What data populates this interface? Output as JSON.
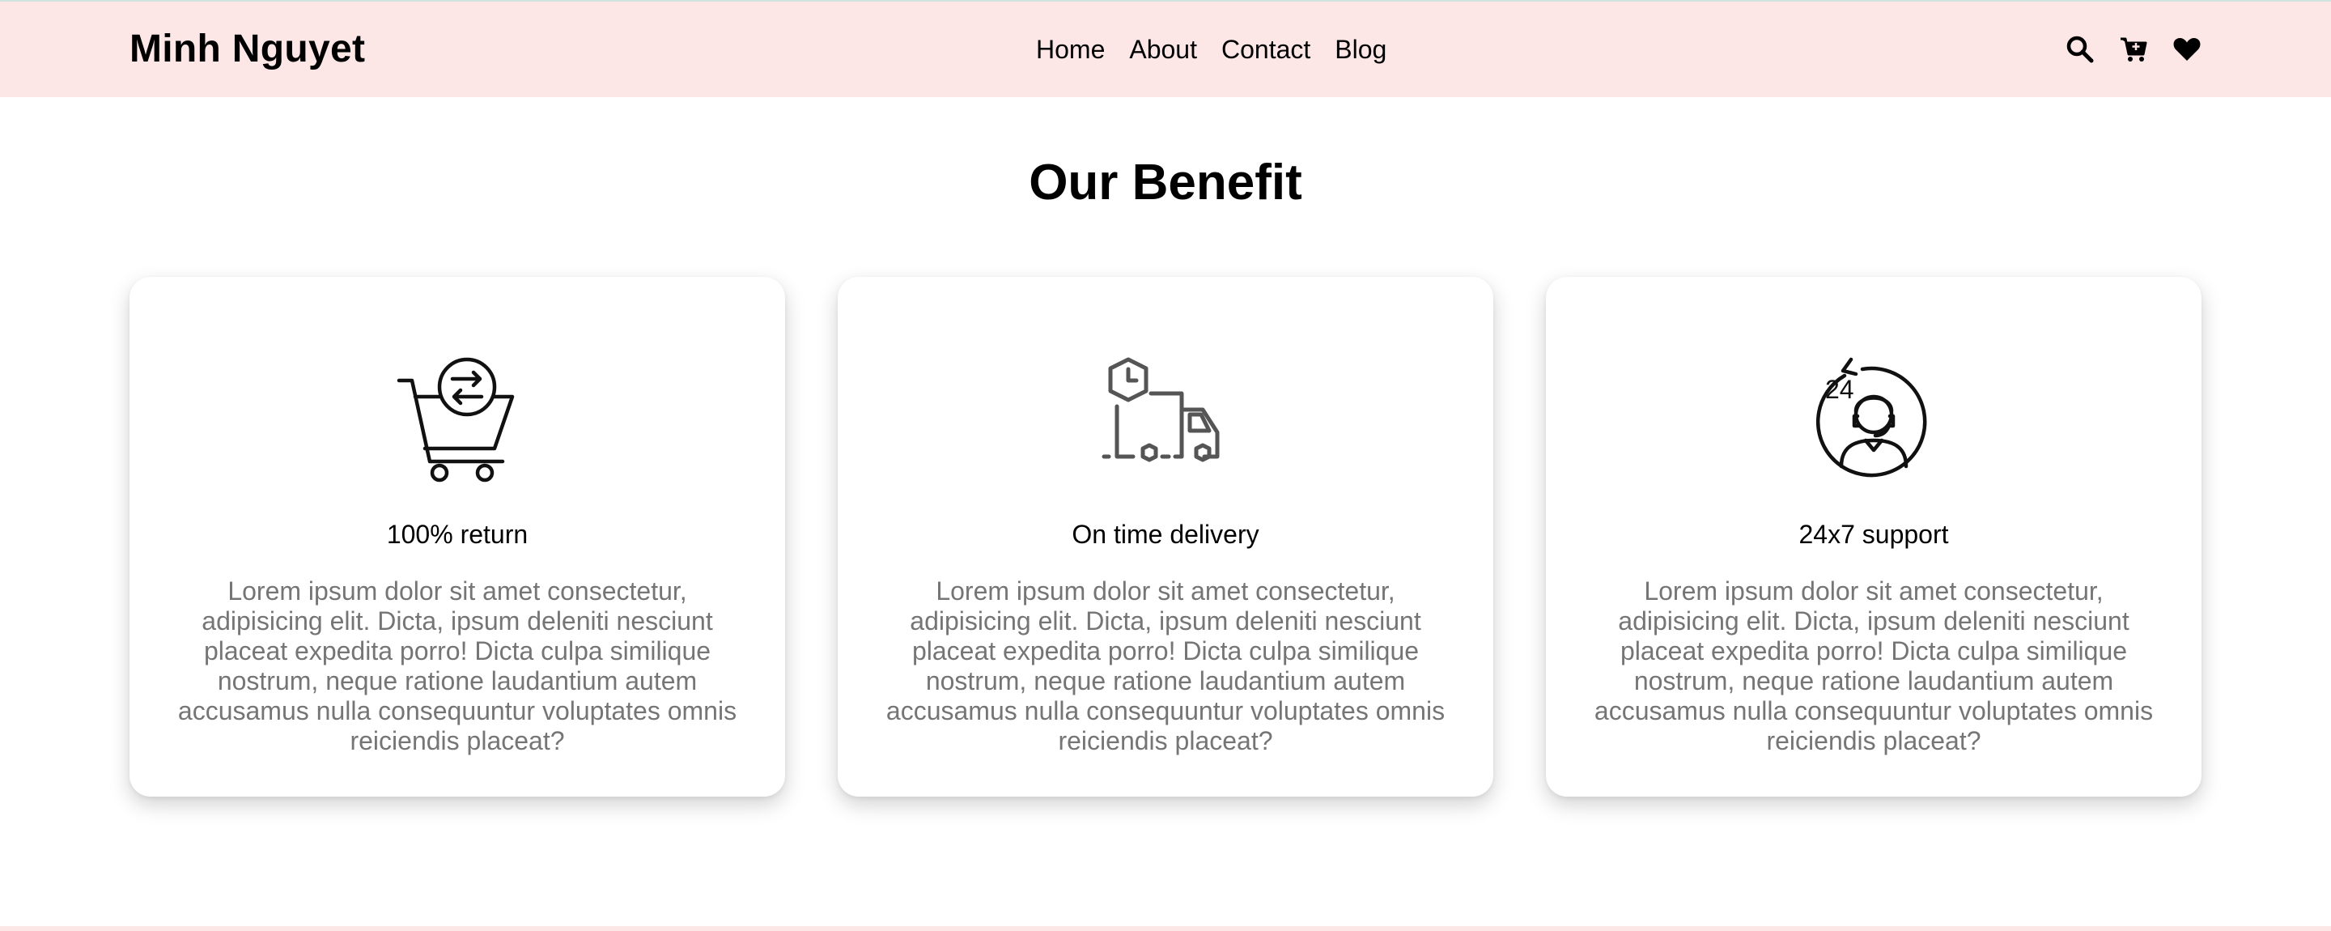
{
  "header": {
    "logo": "Minh Nguyet",
    "nav": [
      "Home",
      "About",
      "Contact",
      "Blog"
    ],
    "icons": [
      "search-icon",
      "cart-icon",
      "heart-icon"
    ],
    "background": "#fce6e6"
  },
  "section": {
    "title": "Our Benefit",
    "cards": [
      {
        "icon": "cart-return-icon",
        "title": "100% return",
        "description": "Lorem ipsum dolor sit amet consectetur, adipisicing elit. Dicta, ipsum deleniti nesciunt placeat expedita porro! Dicta culpa similique nostrum, neque ratione laudantium autem accusamus nulla consequuntur voluptates omnis reiciendis placeat?"
      },
      {
        "icon": "delivery-truck-icon",
        "title": "On time delivery",
        "description": "Lorem ipsum dolor sit amet consectetur, adipisicing elit. Dicta, ipsum deleniti nesciunt placeat expedita porro! Dicta culpa similique nostrum, neque ratione laudantium autem accusamus nulla consequuntur voluptates omnis reiciendis placeat?"
      },
      {
        "icon": "support-24-icon",
        "title": "24x7 support",
        "description": "Lorem ipsum dolor sit amet consectetur, adipisicing elit. Dicta, ipsum deleniti nesciunt placeat expedita porro! Dicta culpa similique nostrum, neque ratione laudantium autem accusamus nulla consequuntur voluptates omnis reiciendis placeat?"
      }
    ],
    "support_icon_text": "24"
  }
}
